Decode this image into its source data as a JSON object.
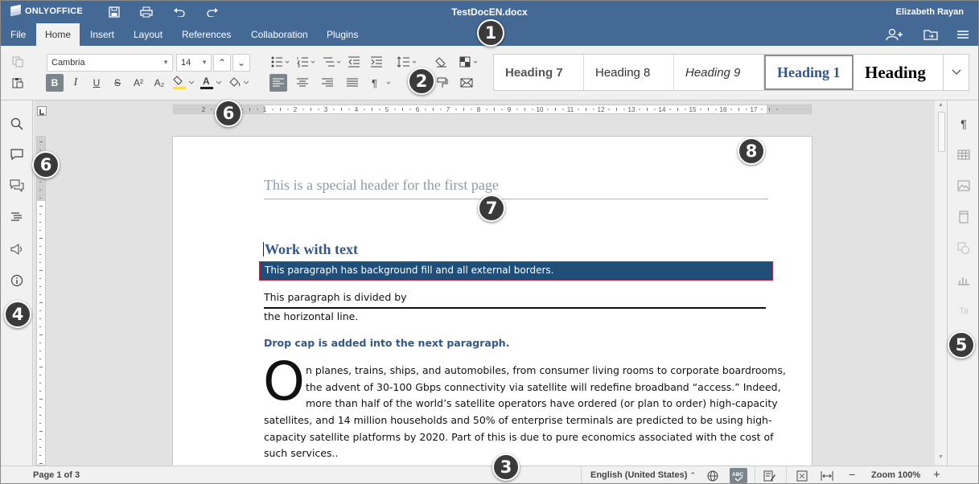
{
  "app": {
    "brand": "ONLYOFFICE",
    "document_title": "TestDocEN.docx",
    "user_name": "Elizabeth Rayan"
  },
  "menu_tabs": [
    "File",
    "Home",
    "Insert",
    "Layout",
    "References",
    "Collaboration",
    "Plugins"
  ],
  "active_tab": "Home",
  "toolbar": {
    "font_name": "Cambria",
    "font_size": "14",
    "style_gallery": [
      "Heading 7",
      "Heading 8",
      "Heading 9",
      "Heading 1",
      "Heading"
    ],
    "selected_style": "Heading 1",
    "colors": {
      "highlight": "#f7e04b",
      "font_color": "#1e1e1e",
      "brand": "#446995"
    }
  },
  "ruler": {
    "horizontal_numbers": [
      "2",
      "1",
      "1",
      "2",
      "3",
      "4",
      "5",
      "6",
      "7",
      "8",
      "9",
      "10",
      "11",
      "12",
      "13",
      "14",
      "15",
      "16",
      "17"
    ]
  },
  "document": {
    "header_text": "This is a special header for the first page",
    "heading": "Work with text",
    "fill_paragraph": "This paragraph has background fill and all external borders.",
    "divided_line1": "This paragraph is divided by",
    "divided_line2": "the horizontal line.",
    "dropcap_title": "Drop cap is added into the next paragraph.",
    "dropcap_letter": "O",
    "body_lines": [
      "n planes, trains, ships, and automobiles, from consumer living rooms to  corporate boardrooms,",
      "the advent of 30-100 Gbps connectivity via  satellite will redefine broadband “access.” Indeed,",
      "more than half of  the world’s satellite operators have ordered (or plan to order)  high-capacity",
      "satellites, and 14 million households and 50% of  enterprise terminals are predicted to be using high-",
      "capacity satellite  platforms by 2020. Part of this is due to pure economics associated with  the cost of",
      "such services.."
    ],
    "fill_color": "#1f4e79"
  },
  "statusbar": {
    "page_info": "Page 1 of 3",
    "language": "English (United States)",
    "zoom": "Zoom 100%"
  },
  "callouts": [
    "1",
    "2",
    "3",
    "4",
    "5",
    "6",
    "6",
    "7",
    "8"
  ]
}
